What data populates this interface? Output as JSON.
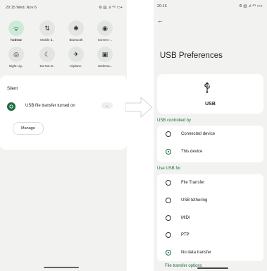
{
  "left": {
    "status": {
      "time_date": "20:15 Wed, Nov 6",
      "icons": "⚙ ▥ .ıl ⁴ᴳ ▭+"
    },
    "quick_settings": [
      {
        "label": "hodes2",
        "icon": "wifi-icon",
        "glyph": "ᯤ",
        "active": true
      },
      {
        "label": "Mobile d..",
        "icon": "mobile-data-icon",
        "glyph": "⇅",
        "active": false
      },
      {
        "label": "Bluetooth",
        "icon": "bluetooth-icon",
        "glyph": "✱",
        "active": false
      },
      {
        "label": "Screen r...",
        "icon": "screen-record-icon",
        "glyph": "◉",
        "active": false
      },
      {
        "label": "Night Lig..",
        "icon": "night-light-icon",
        "glyph": "◎",
        "active": false
      },
      {
        "label": "Do Not D..",
        "icon": "dnd-icon",
        "glyph": "☾",
        "active": false
      },
      {
        "label": "Airplane..",
        "icon": "airplane-icon",
        "glyph": "✈",
        "active": false
      },
      {
        "label": "Undersa...",
        "icon": "undersaturated-icon",
        "glyph": "▣",
        "active": false
      }
    ],
    "silent_label": "Silent",
    "notification_text": "USB file transfer turned on",
    "manage_label": "Manage"
  },
  "right": {
    "status": {
      "time": "20:15",
      "icons": "⚙ ▥ .ıl ⁴ᴳ ▭+"
    },
    "back_glyph": "←",
    "title": "USB Preferences",
    "usb_label": "USB",
    "section_controlled": "USB controlled by",
    "controlled_options": [
      {
        "label": "Connected device",
        "selected": false
      },
      {
        "label": "This device",
        "selected": true
      }
    ],
    "section_use": "Use USB for",
    "use_options": [
      {
        "label": "File Transfer",
        "selected": false
      },
      {
        "label": "USB tethering",
        "selected": false
      },
      {
        "label": "MIDI",
        "selected": false
      },
      {
        "label": "PTP",
        "selected": false
      },
      {
        "label": "No data transfer",
        "selected": true
      }
    ],
    "section_footer": "File transfer options"
  },
  "colors": {
    "accent": "#1b6b3a",
    "panel_bg": "#f2f3f1"
  }
}
